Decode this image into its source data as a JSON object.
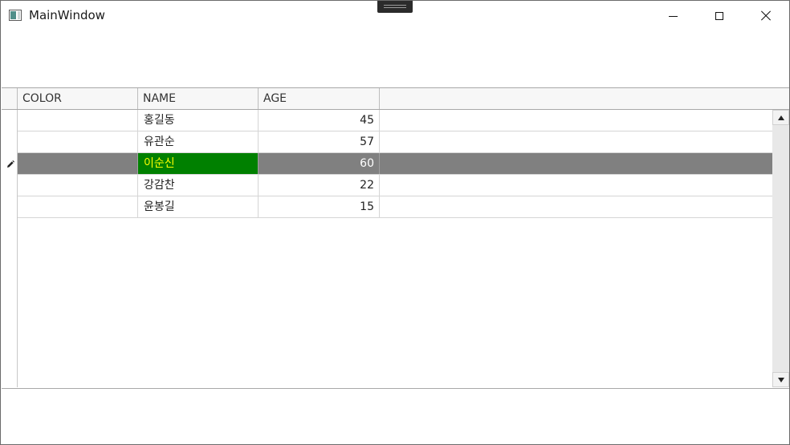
{
  "window": {
    "title": "MainWindow"
  },
  "grid": {
    "columns": [
      "COLOR",
      "NAME",
      "AGE"
    ],
    "rows": [
      {
        "color": "",
        "name": "홍길동",
        "age": "45"
      },
      {
        "color": "",
        "name": "유관순",
        "age": "57"
      },
      {
        "color": "",
        "name": "이순신",
        "age": "60"
      },
      {
        "color": "",
        "name": "강감찬",
        "age": "22"
      },
      {
        "color": "",
        "name": "윤봉길",
        "age": "15"
      }
    ],
    "selected_row_index": 2,
    "colors": {
      "selected_row_background": "#808080",
      "selected_name_background": "#008000",
      "selected_name_text": "#ffff00"
    }
  },
  "icons": {
    "row_edit": "pencil-icon",
    "app": "window-app-icon",
    "minimize": "minimize-icon",
    "maximize": "maximize-icon",
    "close": "close-icon",
    "scroll_up": "scroll-up-arrow-icon",
    "scroll_down": "scroll-down-arrow-icon"
  }
}
